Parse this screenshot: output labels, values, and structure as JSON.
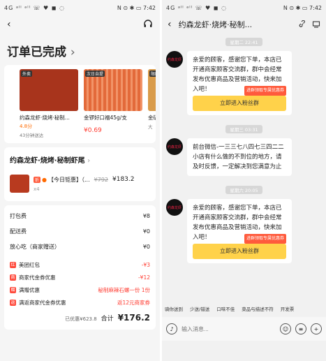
{
  "left": {
    "status": {
      "signal": "4G ᵃˡˡ ᵃˡˡ ☏ ♥ ◼ ◌",
      "right": "N ⊙ ✱ ▭ 7:42"
    },
    "nav": {
      "back": "‹",
      "service_icon": "headset-icon"
    },
    "order_title": "订单已完成",
    "order_title_chevron": "›",
    "products": [
      {
        "tag": "外卖",
        "name": "约森龙虾·烧烤·秘制...",
        "rate": "4.8分",
        "sub": "43分钟送达",
        "price": ""
      },
      {
        "tag": "次日自提",
        "name": "金锣好口福45g/支",
        "rate": "",
        "sub": "",
        "price": "¥0.69"
      },
      {
        "tag": "限时",
        "name": "金矿",
        "rate": "",
        "sub": "大",
        "price": ""
      }
    ],
    "shop_name": "约森龙虾·烧烤·秘制虾尾",
    "shop_chevron": "›",
    "item": {
      "badge": "折",
      "label": "【今日钜惠】（...",
      "original": "¥792",
      "price": "¥183.2",
      "qty": "x4"
    },
    "fees": [
      {
        "label": "打包费",
        "value": "¥8"
      },
      {
        "label": "配送费",
        "value": "¥0"
      },
      {
        "label": "放心吃（商家赠送）",
        "value": "¥0"
      }
    ],
    "discounts": [
      {
        "icon": "红",
        "label": "美团红包",
        "value": "-¥3"
      },
      {
        "icon": "商",
        "label": "商家代金券优惠",
        "value": "-¥12"
      },
      {
        "icon": "赠",
        "label": "满赠优惠",
        "value": "秘制麻辣石螺一份 1份"
      },
      {
        "icon": "返",
        "label": "满返商家代金券优惠",
        "value": "返12元商家券"
      }
    ],
    "total": {
      "saved": "已优惠¥623.8",
      "label": "合计",
      "amount": "¥176.2"
    }
  },
  "right": {
    "status": {
      "signal": "4G ᵃˡˡ ᵃˡˡ ☏ ♥ ◼ ◌",
      "right": "N ⊙ ✱ ▭ 7:42"
    },
    "nav": {
      "back": "‹",
      "title": "约森龙虾·烧烤·秘制...",
      "icon1": "link-icon",
      "icon2": "store-icon"
    },
    "messages": [
      {
        "time": "星期二 22:41",
        "text": "亲爱的顾客，感谢您下单，本店已开通商家顾客交流群，群中会经常发布优惠商品及营销活动，快来加入吧！",
        "coupon": "进群领取专属优惠券",
        "button": "立即进入粉丝群"
      },
      {
        "time": "星期三 03:31",
        "text": "前台微信-一三三七八四七三四二二     小店有什么做的不到位的地方，请及时反馈，一定解决到您满意为止",
        "coupon": "",
        "button": ""
      },
      {
        "time": "星期六 20:05",
        "text": "亲爱的顾客，感谢您下单，本店已开通商家顾客交流群，群中会经常发布优惠商品及营销活动，快来加入吧！",
        "coupon": "进群领取专属优惠券",
        "button": "立即进入粉丝群"
      }
    ],
    "quick_replies": [
      "骑你送到",
      "少送/错送",
      "口味不佳",
      "菜品与描述不符",
      "开发票"
    ],
    "input_placeholder": "输入消息...",
    "avatar_text": "约森龙虾"
  }
}
